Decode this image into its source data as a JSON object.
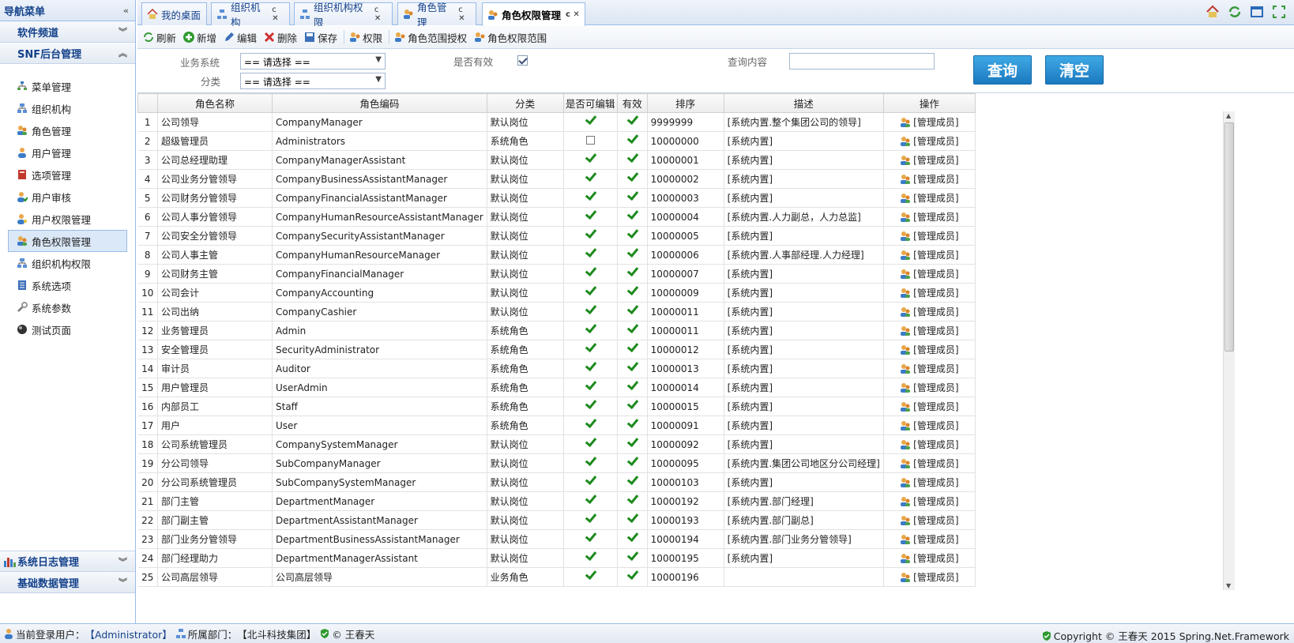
{
  "sidebar": {
    "title": "导航菜单",
    "panels": [
      {
        "label": "软件频道"
      },
      {
        "label": "SNF后台管理"
      }
    ],
    "items": [
      {
        "label": "菜单管理",
        "icon": "tree-icon"
      },
      {
        "label": "组织机构",
        "icon": "org-icon"
      },
      {
        "label": "角色管理",
        "icon": "role-icon"
      },
      {
        "label": "用户管理",
        "icon": "user-icon"
      },
      {
        "label": "选项管理",
        "icon": "book-icon"
      },
      {
        "label": "用户审核",
        "icon": "user-check-icon"
      },
      {
        "label": "用户权限管理",
        "icon": "user-key-icon"
      },
      {
        "label": "角色权限管理",
        "icon": "role-key-icon"
      },
      {
        "label": "组织机构权限",
        "icon": "org-key-icon"
      },
      {
        "label": "系统选项",
        "icon": "list-icon"
      },
      {
        "label": "系统参数",
        "icon": "wrench-icon"
      },
      {
        "label": "测试页面",
        "icon": "ball-icon"
      }
    ],
    "bottom_panels": [
      {
        "label": "系统日志管理"
      },
      {
        "label": "基础数据管理"
      }
    ]
  },
  "tabs": [
    {
      "label": "我的桌面"
    },
    {
      "label": "组织机构"
    },
    {
      "label": "组织机构权限"
    },
    {
      "label": "角色管理"
    },
    {
      "label": "角色权限管理"
    }
  ],
  "toolbar": {
    "refresh": "刷新",
    "add": "新增",
    "edit": "编辑",
    "delete": "删除",
    "save": "保存",
    "permission": "权限",
    "scope_grant": "角色范围授权",
    "scope": "角色权限范围"
  },
  "search": {
    "category_label": "业务系统",
    "category_value": "== 请选择 ==",
    "type_label": "分类",
    "type_value": "== 请选择 ==",
    "valid_label": "是否有效",
    "valid_checked": true,
    "query_label": "查询内容",
    "query_value": "",
    "query_button": "查询",
    "clear_button": "清空"
  },
  "grid": {
    "columns": [
      "",
      "角色名称",
      "角色编码",
      "分类",
      "是否可编辑",
      "有效",
      "排序",
      "描述",
      "操作"
    ],
    "manage_label": "[管理成员]",
    "rows": [
      {
        "n": "1",
        "name": "公司领导",
        "code": "CompanyManager",
        "cat": "默认岗位",
        "edit": true,
        "valid": true,
        "sort": "9999999",
        "desc": "[系统内置.整个集团公司的领导]"
      },
      {
        "n": "2",
        "name": "超级管理员",
        "code": "Administrators",
        "cat": "系统角色",
        "edit": false,
        "valid": true,
        "sort": "10000000",
        "desc": "[系统内置]"
      },
      {
        "n": "3",
        "name": "公司总经理助理",
        "code": "CompanyManagerAssistant",
        "cat": "默认岗位",
        "edit": true,
        "valid": true,
        "sort": "10000001",
        "desc": "[系统内置]"
      },
      {
        "n": "4",
        "name": "公司业务分管领导",
        "code": "CompanyBusinessAssistantManager",
        "cat": "默认岗位",
        "edit": true,
        "valid": true,
        "sort": "10000002",
        "desc": "[系统内置]"
      },
      {
        "n": "5",
        "name": "公司财务分管领导",
        "code": "CompanyFinancialAssistantManager",
        "cat": "默认岗位",
        "edit": true,
        "valid": true,
        "sort": "10000003",
        "desc": "[系统内置]"
      },
      {
        "n": "6",
        "name": "公司人事分管领导",
        "code": "CompanyHumanResourceAssistantManager",
        "cat": "默认岗位",
        "edit": true,
        "valid": true,
        "sort": "10000004",
        "desc": "[系统内置.人力副总，人力总监]"
      },
      {
        "n": "7",
        "name": "公司安全分管领导",
        "code": "CompanySecurityAssistantManager",
        "cat": "默认岗位",
        "edit": true,
        "valid": true,
        "sort": "10000005",
        "desc": "[系统内置]"
      },
      {
        "n": "8",
        "name": "公司人事主管",
        "code": "CompanyHumanResourceManager",
        "cat": "默认岗位",
        "edit": true,
        "valid": true,
        "sort": "10000006",
        "desc": "[系统内置.人事部经理.人力经理]"
      },
      {
        "n": "9",
        "name": "公司财务主管",
        "code": "CompanyFinancialManager",
        "cat": "默认岗位",
        "edit": true,
        "valid": true,
        "sort": "10000007",
        "desc": "[系统内置]"
      },
      {
        "n": "10",
        "name": "公司会计",
        "code": "CompanyAccounting",
        "cat": "默认岗位",
        "edit": true,
        "valid": true,
        "sort": "10000009",
        "desc": "[系统内置]"
      },
      {
        "n": "11",
        "name": "公司出纳",
        "code": "CompanyCashier",
        "cat": "默认岗位",
        "edit": true,
        "valid": true,
        "sort": "10000011",
        "desc": "[系统内置]"
      },
      {
        "n": "12",
        "name": "业务管理员",
        "code": "Admin",
        "cat": "系统角色",
        "edit": true,
        "valid": true,
        "sort": "10000011",
        "desc": "[系统内置]"
      },
      {
        "n": "13",
        "name": "安全管理员",
        "code": "SecurityAdministrator",
        "cat": "系统角色",
        "edit": true,
        "valid": true,
        "sort": "10000012",
        "desc": "[系统内置]"
      },
      {
        "n": "14",
        "name": "审计员",
        "code": "Auditor",
        "cat": "系统角色",
        "edit": true,
        "valid": true,
        "sort": "10000013",
        "desc": "[系统内置]"
      },
      {
        "n": "15",
        "name": "用户管理员",
        "code": "UserAdmin",
        "cat": "系统角色",
        "edit": true,
        "valid": true,
        "sort": "10000014",
        "desc": "[系统内置]"
      },
      {
        "n": "16",
        "name": "内部员工",
        "code": "Staff",
        "cat": "系统角色",
        "edit": true,
        "valid": true,
        "sort": "10000015",
        "desc": "[系统内置]"
      },
      {
        "n": "17",
        "name": "用户",
        "code": "User",
        "cat": "系统角色",
        "edit": true,
        "valid": true,
        "sort": "10000091",
        "desc": "[系统内置]"
      },
      {
        "n": "18",
        "name": "公司系统管理员",
        "code": "CompanySystemManager",
        "cat": "默认岗位",
        "edit": true,
        "valid": true,
        "sort": "10000092",
        "desc": "[系统内置]"
      },
      {
        "n": "19",
        "name": "分公司领导",
        "code": "SubCompanyManager",
        "cat": "默认岗位",
        "edit": true,
        "valid": true,
        "sort": "10000095",
        "desc": "[系统内置.集团公司地区分公司经理]"
      },
      {
        "n": "20",
        "name": "分公司系统管理员",
        "code": "SubCompanySystemManager",
        "cat": "默认岗位",
        "edit": true,
        "valid": true,
        "sort": "10000103",
        "desc": "[系统内置]"
      },
      {
        "n": "21",
        "name": "部门主管",
        "code": "DepartmentManager",
        "cat": "默认岗位",
        "edit": true,
        "valid": true,
        "sort": "10000192",
        "desc": "[系统内置.部门经理]"
      },
      {
        "n": "22",
        "name": "部门副主管",
        "code": "DepartmentAssistantManager",
        "cat": "默认岗位",
        "edit": true,
        "valid": true,
        "sort": "10000193",
        "desc": "[系统内置.部门副总]"
      },
      {
        "n": "23",
        "name": "部门业务分管领导",
        "code": "DepartmentBusinessAssistantManager",
        "cat": "默认岗位",
        "edit": true,
        "valid": true,
        "sort": "10000194",
        "desc": "[系统内置.部门业务分管领导]"
      },
      {
        "n": "24",
        "name": "部门经理助力",
        "code": "DepartmentManagerAssistant",
        "cat": "默认岗位",
        "edit": true,
        "valid": true,
        "sort": "10000195",
        "desc": "[系统内置]"
      },
      {
        "n": "25",
        "name": "公司高层领导",
        "code": "公司高层领导",
        "cat": "业务角色",
        "edit": true,
        "valid": true,
        "sort": "10000196",
        "desc": ""
      }
    ]
  },
  "status": {
    "user_label": "当前登录用户：",
    "user_value": "【Administrator】",
    "dept_label": "所属部门：",
    "dept_value": "【北斗科技集团】",
    "author": "© 王春天",
    "copyright": "Copyright © 王春天 2015 Spring.Net.Framework"
  }
}
